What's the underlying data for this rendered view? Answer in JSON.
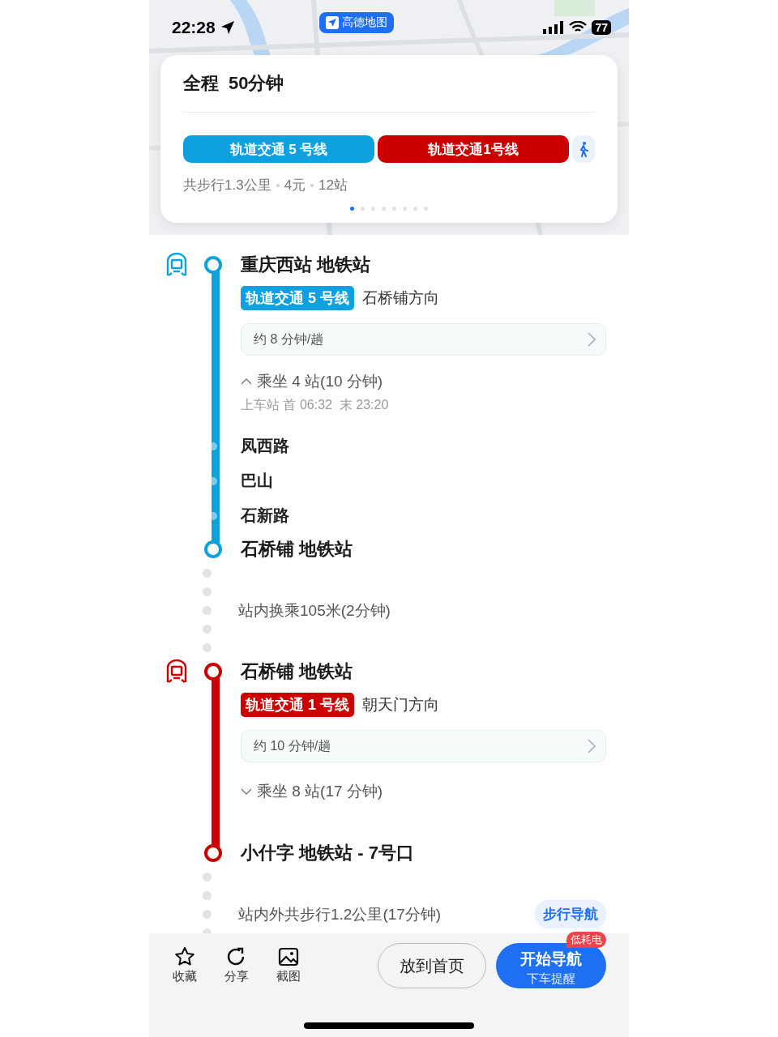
{
  "status_bar": {
    "time": "22:28",
    "app_badge": "高德地图",
    "battery": "77"
  },
  "summary": {
    "label": "全程",
    "duration": "50分钟",
    "lines": [
      {
        "name": "轨道交通 5 号线",
        "color": "#0fa0e0"
      },
      {
        "name": "轨道交通1号线",
        "color": "#cc0000"
      }
    ],
    "info": [
      "共步行1.3公里",
      "4元",
      "12站"
    ],
    "pages": [
      {
        "selected": true
      },
      {
        "selected": false
      },
      {
        "selected": false
      },
      {
        "selected": false
      },
      {
        "selected": false
      },
      {
        "selected": false
      },
      {
        "selected": false
      },
      {
        "selected": false
      }
    ]
  },
  "route": [
    {
      "kind": "transit",
      "color": "#0fa0e0",
      "station": "重庆西站 地铁站",
      "line": "轨道交通 5 号线",
      "direction": "石桥铺方向",
      "frequency": "约 8 分钟/趟",
      "ride": "乘坐 4 站(10 分钟)",
      "expanded": true,
      "timetable": "上车站 首 06:32  末 23:20",
      "stops": [
        "凤西路",
        "巴山",
        "石新路"
      ],
      "end": "石桥铺 地铁站"
    },
    {
      "kind": "walk",
      "text": "站内换乘105米(2分钟)"
    },
    {
      "kind": "transit",
      "color": "#cc0000",
      "station": "石桥铺 地铁站",
      "line": "轨道交通 1 号线",
      "direction": "朝天门方向",
      "frequency": "约 10 分钟/趟",
      "ride": "乘坐 8 站(17 分钟)",
      "expanded": false,
      "end": "小什字 地铁站 - 7号口"
    },
    {
      "kind": "walk",
      "text": "站内外共步行1.2公里(17分钟)",
      "action": "步行导航"
    }
  ],
  "toolbar": {
    "actions": [
      {
        "kind": "star",
        "label": "收藏"
      },
      {
        "kind": "share",
        "label": "分享"
      },
      {
        "kind": "screenshot",
        "label": "截图"
      }
    ],
    "home_button": "放到首页",
    "nav_button": {
      "title": "开始导航",
      "subtitle": "下车提醒",
      "badge": "低耗电"
    }
  }
}
